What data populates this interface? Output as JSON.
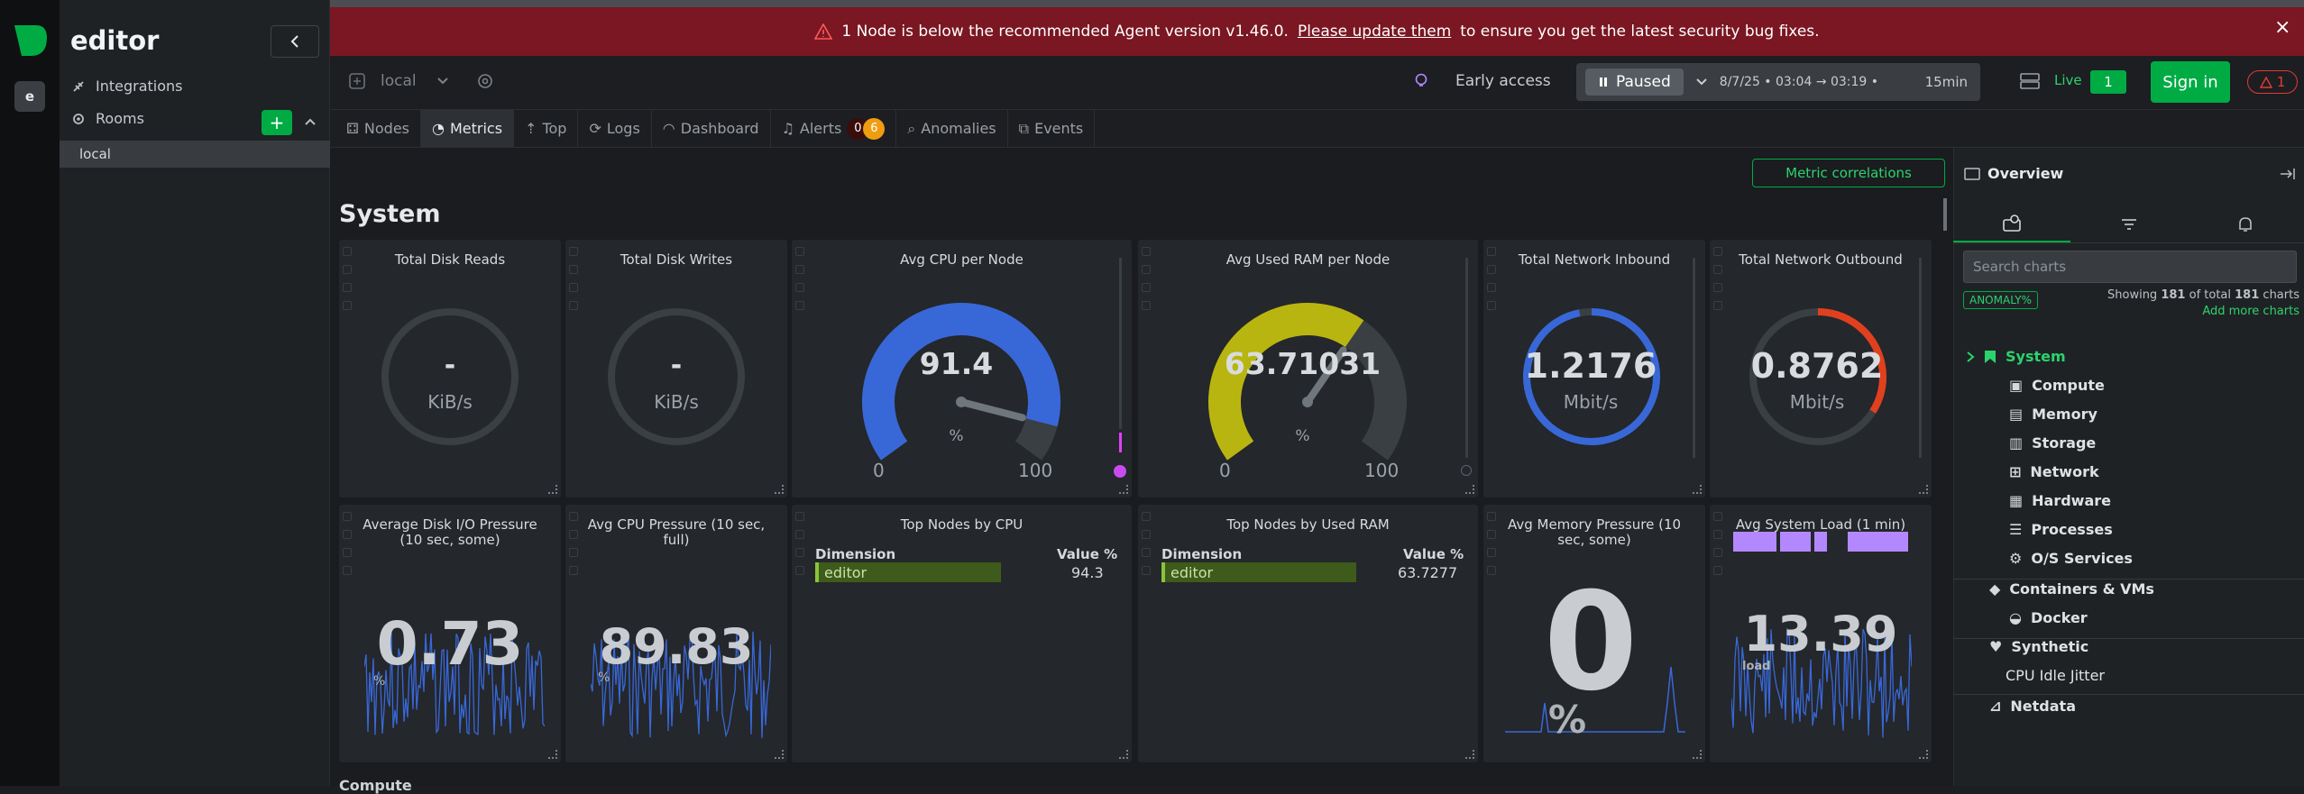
{
  "space": {
    "badge": "e",
    "name": "editor"
  },
  "sidebar": {
    "integrations_label": "Integrations",
    "rooms_label": "Rooms",
    "add_room_label": "+",
    "rooms": [
      "local"
    ]
  },
  "banner": {
    "prefix": "1 Node is below the recommended Agent version v1.46.0.",
    "link": "Please update them",
    "suffix": "to ensure you get the latest security bug fixes.",
    "close": "×"
  },
  "toolbar": {
    "room": "local",
    "early_access": "Early access",
    "paused_label": "Paused",
    "time_range": "8/7/25 • 03:04 → 03:19 •",
    "duration": "15min",
    "live_label": "Live",
    "live_count": "1",
    "signin_label": "Sign in",
    "alert_count": "1"
  },
  "tabs": [
    {
      "label": "Nodes"
    },
    {
      "label": "Metrics"
    },
    {
      "label": "Top"
    },
    {
      "label": "Logs"
    },
    {
      "label": "Dashboard"
    },
    {
      "label": "Alerts"
    },
    {
      "label": "Anomalies"
    },
    {
      "label": "Events"
    }
  ],
  "alerts_badges": {
    "critical": "0",
    "warning": "6"
  },
  "main": {
    "metric_correlations": "Metric correlations",
    "section_title": "System",
    "next_section": "Compute"
  },
  "cards_row1": [
    {
      "title": "Total Disk Reads",
      "value": "-",
      "unit": "KiB/s"
    },
    {
      "title": "Total Disk Writes",
      "value": "-",
      "unit": "KiB/s"
    },
    {
      "title": "Avg CPU per Node",
      "value": "91.4",
      "unit": "%",
      "min": "0",
      "max": "100",
      "fill": 0.914
    },
    {
      "title": "Avg Used RAM per Node",
      "value": "63.71031",
      "unit": "%",
      "min": "0",
      "max": "100",
      "fill": 0.637
    },
    {
      "title": "Total Network Inbound",
      "value": "1.2176",
      "unit": "Mbit/s",
      "fill": 0.97
    },
    {
      "title": "Total Network Outbound",
      "value": "0.8762",
      "unit": "Mbit/s",
      "fill": 0.34
    }
  ],
  "cards_row2": [
    {
      "title": "Average Disk I/O Pressure (10 sec, some)",
      "value": "0.73",
      "unit": "%"
    },
    {
      "title": "Avg CPU Pressure (10 sec, full)",
      "value": "89.83",
      "unit": "%"
    },
    {
      "title": "Top Nodes by CPU",
      "col_dim": "Dimension",
      "col_val": "Value %",
      "row_name": "editor",
      "row_value": "94.3"
    },
    {
      "title": "Top Nodes by Used RAM",
      "col_dim": "Dimension",
      "col_val": "Value %",
      "row_name": "editor",
      "row_value": "63.7277"
    },
    {
      "title": "Avg Memory Pressure (10 sec, some)",
      "value": "0",
      "unit": "%"
    },
    {
      "title": "Avg System Load (1 min)",
      "value": "13.39",
      "unit": "load"
    }
  ],
  "colors": {
    "accent": "#00ab44",
    "cpu_gauge": "#3868d8",
    "ram_gauge": "#b9b510",
    "outbound": "#e0401e",
    "banner": "#7a1722"
  },
  "overview": {
    "title": "Overview",
    "search_placeholder": "Search charts",
    "anomaly_badge": "ANOMALY%",
    "showing_prefix": "Showing",
    "showing_count": "181",
    "showing_mid": "of total",
    "showing_total": "181",
    "showing_suffix": "charts",
    "add_more": "Add more charts",
    "tree": [
      {
        "label": "System",
        "icon": "bookmark-icon"
      },
      {
        "label": "Compute",
        "icon": "cpu-icon"
      },
      {
        "label": "Memory",
        "icon": "memory-icon"
      },
      {
        "label": "Storage",
        "icon": "storage-icon"
      },
      {
        "label": "Network",
        "icon": "network-icon"
      },
      {
        "label": "Hardware",
        "icon": "hardware-icon"
      },
      {
        "label": "Processes",
        "icon": "processes-icon"
      },
      {
        "label": "O/S Services",
        "icon": "services-icon"
      },
      {
        "label": "Containers & VMs",
        "icon": "containers-icon"
      },
      {
        "label": "Docker",
        "icon": "docker-icon"
      },
      {
        "label": "Synthetic",
        "icon": "synthetic-icon"
      },
      {
        "label": "CPU Idle Jitter",
        "icon": ""
      },
      {
        "label": "Netdata",
        "icon": "netdata-icon"
      }
    ]
  }
}
